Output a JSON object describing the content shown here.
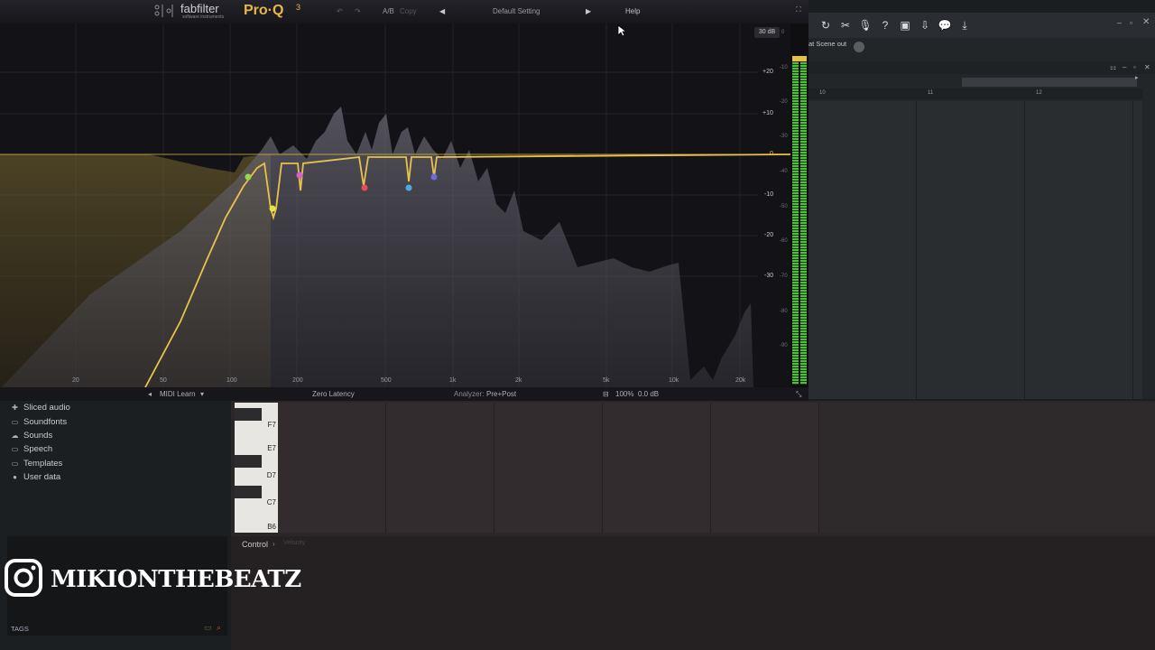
{
  "proq": {
    "brand": "fabfilter",
    "brand_sub": "software instruments",
    "product": "Pro·Q",
    "version": "3",
    "ab_label": "A/B",
    "copy_label": "Copy",
    "preset": "Default Setting",
    "help": "Help",
    "range_label": "30 dB",
    "gain_labels": [
      "+20",
      "+10",
      "0",
      "-10",
      "-20",
      "-30"
    ],
    "meter_labels": [
      "0",
      "-10",
      "-20",
      "-30",
      "-40",
      "-50",
      "-60",
      "-70",
      "-80",
      "-90"
    ],
    "freq_labels": [
      "20",
      "50",
      "100",
      "200",
      "500",
      "1k",
      "2k",
      "5k",
      "10k",
      "20k"
    ],
    "footer": {
      "midi_learn": "MIDI Learn",
      "latency": "Zero Latency",
      "analyzer_label": "Analyzer:",
      "analyzer_value": "Pre+Post",
      "zoom": "100%",
      "gain": "0.0 dB"
    },
    "bands": [
      {
        "color": "#8fdc4a"
      },
      {
        "color": "#e6e34a"
      },
      {
        "color": "#d65fd6"
      },
      {
        "color": "#ec4a5a"
      },
      {
        "color": "#4fa8e8"
      },
      {
        "color": "#6e6ae0"
      }
    ]
  },
  "fl": {
    "scene_out": "at Scene out",
    "ruler": [
      "10",
      "11",
      "12"
    ]
  },
  "browser": {
    "items": [
      {
        "label": "Sliced audio",
        "icon": "plus-icon"
      },
      {
        "label": "Soundfonts",
        "icon": "folder-icon"
      },
      {
        "label": "Sounds",
        "icon": "cloud-icon"
      },
      {
        "label": "Speech",
        "icon": "folder-icon"
      },
      {
        "label": "Templates",
        "icon": "folder-icon"
      },
      {
        "label": "User data",
        "icon": "user-icon"
      }
    ],
    "tags": "TAGS"
  },
  "pianoroll": {
    "keys": [
      "F7",
      "E7",
      "D7",
      "C7",
      "B6"
    ],
    "control": "Control",
    "velocity": "Velocity"
  },
  "watermark": "MIKIONTHEBEATZ"
}
